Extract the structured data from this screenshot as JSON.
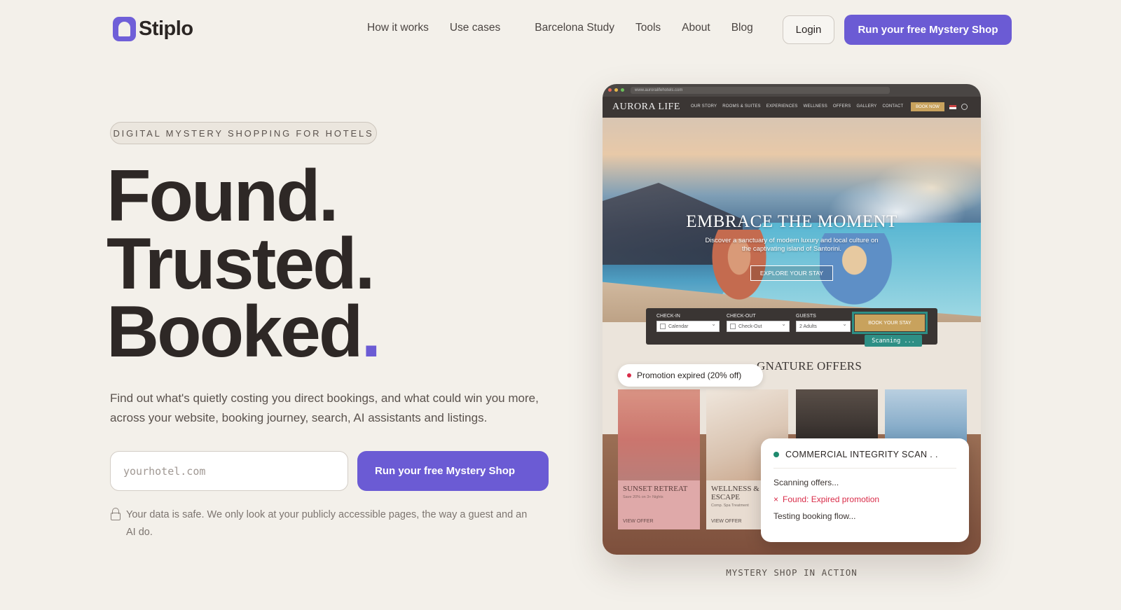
{
  "nav": {
    "brand": "Stiplo",
    "links": [
      "How it works",
      "Use cases",
      "Barcelona Study",
      "Tools",
      "About",
      "Blog"
    ],
    "login": "Login",
    "cta": "Run your free Mystery Shop"
  },
  "hero": {
    "eyebrow": "DIGITAL MYSTERY SHOPPING FOR HOTELS",
    "line1": "Found.",
    "line2": "Trusted.",
    "line3": "Booked",
    "dot": ".",
    "subtitle": "Find out what's quietly costing you direct bookings, and what could win you more, across your website, booking journey, search, AI assistants and listings.",
    "input_placeholder": "yourhotel.com",
    "cta": "Run your free Mystery Shop",
    "safe_note": "Your data is safe. We only look at your publicly accessible pages, the way a guest and an AI do."
  },
  "mockup": {
    "url": "www.auroralifehotels.com",
    "site_brand": "AURORA LIFE",
    "site_menu": [
      "OUR STORY",
      "ROOMS & SUITES",
      "EXPERIENCES",
      "WELLNESS",
      "OFFERS",
      "GALLERY",
      "CONTACT"
    ],
    "site_book": "BOOK NOW",
    "hero_title": "EMBRACE THE MOMENT",
    "hero_desc": "Discover a sanctuary of modern luxury and local culture on the captivating island of Santorini.",
    "hero_button": "EXPLORE YOUR STAY",
    "booking": {
      "checkin_label": "CHECK-IN",
      "checkin_value": "Calendar",
      "checkout_label": "CHECK-OUT",
      "checkout_value": "Check-Out",
      "guests_label": "GUESTS",
      "guests_value": "2 Adults",
      "button": "BOOK YOUR STAY"
    },
    "scanning_tag": "Scanning ...",
    "offers_title": "GNATURE OFFERS",
    "promo_pill": "Promotion expired (20% off)",
    "cards": [
      {
        "title": "SUNSET RETREAT",
        "small": "Save 20% on 3+ Nights",
        "link": "VIEW OFFER"
      },
      {
        "title": "WELLNESS & ESCAPE",
        "small": "Comp. Spa Treatment",
        "link": "VIEW OFFER"
      }
    ],
    "scan": {
      "title": "COMMERCIAL INTEGRITY SCAN . .",
      "line1": "Scanning offers...",
      "alert": "Found: Expired promotion",
      "line3": "Testing booking flow..."
    }
  },
  "caption": "MYSTERY SHOP IN ACTION",
  "colors": {
    "accent": "#6b5bd4",
    "background": "#f3f0ea",
    "scan_green": "#2e8f85",
    "alert_red": "#d92c49"
  }
}
